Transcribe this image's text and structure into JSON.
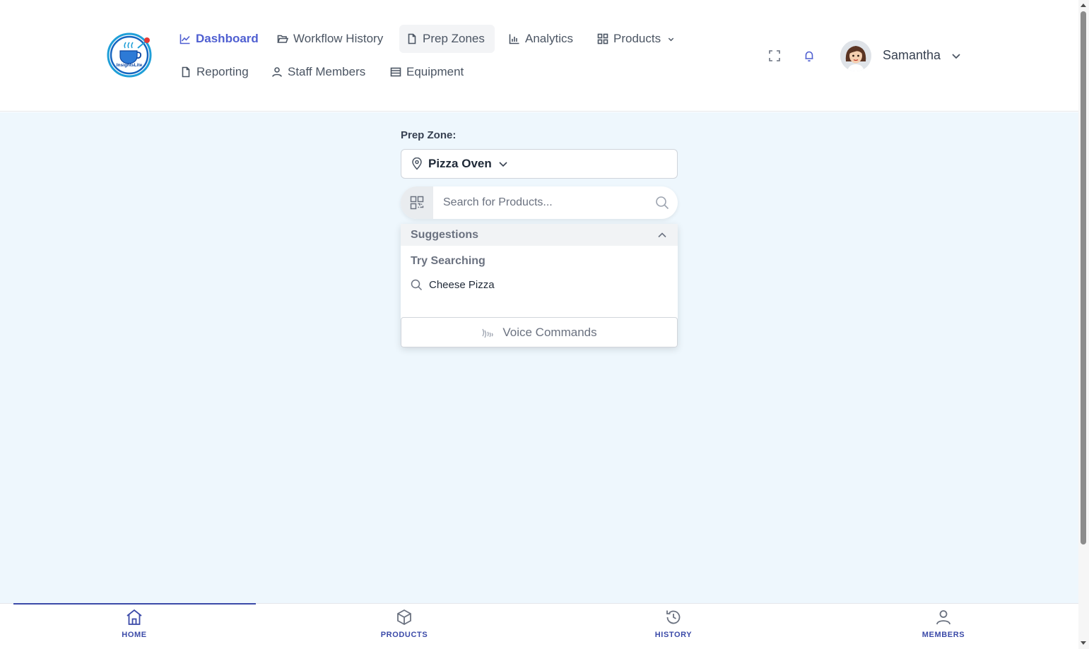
{
  "header": {
    "logo_text": "InsightsLite",
    "nav": {
      "dashboard": "Dashboard",
      "workflow_history": "Workflow History",
      "prep_zones": "Prep Zones",
      "analytics": "Analytics",
      "products": "Products",
      "reporting": "Reporting",
      "staff_members": "Staff Members",
      "equipment": "Equipment"
    },
    "user": {
      "name": "Samantha"
    }
  },
  "main": {
    "prep_zone_label": "Prep Zone:",
    "prep_zone_value": "Pizza Oven",
    "search": {
      "placeholder": "Search for Products...",
      "value": ""
    },
    "suggestions": {
      "header": "Suggestions",
      "try_label": "Try Searching",
      "items": [
        "Cheese Pizza"
      ],
      "voice_label": "Voice Commands"
    }
  },
  "bottom_nav": {
    "items": [
      {
        "label": "HOME",
        "icon": "home-icon"
      },
      {
        "label": "PRODUCTS",
        "icon": "box-icon"
      },
      {
        "label": "HISTORY",
        "icon": "history-icon"
      },
      {
        "label": "MEMBERS",
        "icon": "user-icon"
      }
    ]
  },
  "colors": {
    "accent": "#4f5fd1",
    "bottom_nav_text": "#3b4aa8",
    "main_bg": "#eef7fd"
  }
}
